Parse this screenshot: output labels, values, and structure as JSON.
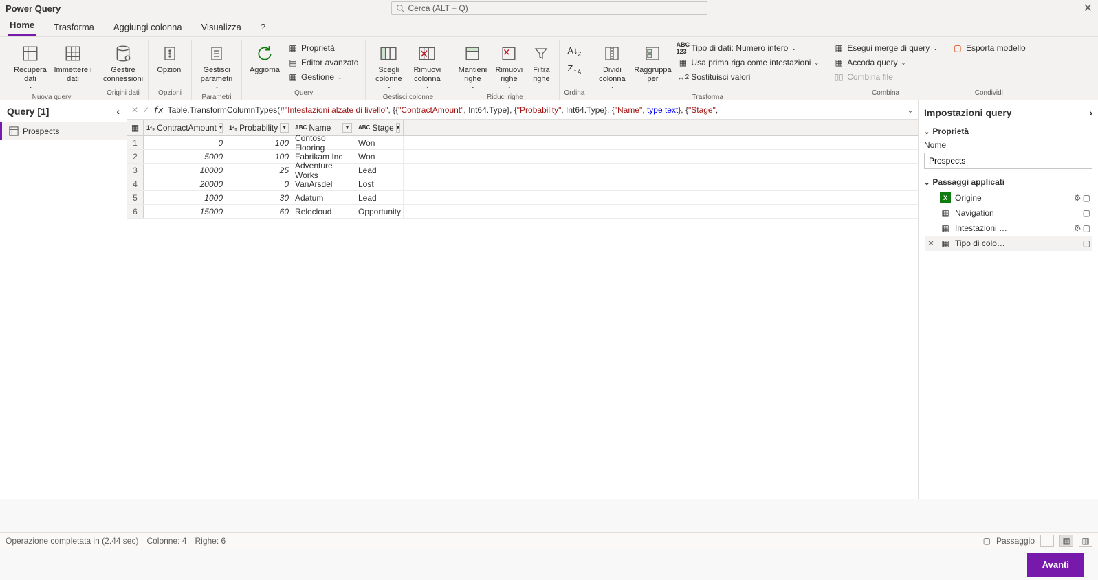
{
  "app_title": "Power Query",
  "search_placeholder": "Cerca (ALT + Q)",
  "tabs": [
    "Home",
    "Trasforma",
    "Aggiungi colonna",
    "Visualizza",
    "?"
  ],
  "active_tab": 0,
  "ribbon": {
    "groups": {
      "nuova_query": {
        "label": "Nuova query",
        "recupera": "Recupera dati",
        "immettere": "Immettere i dati"
      },
      "origini_dati": {
        "label": "Origini dati",
        "gestire": "Gestire connessioni"
      },
      "opzioni": {
        "label": "Opzioni",
        "opzioni": "Opzioni"
      },
      "parametri": {
        "label": "Parametri",
        "gestisci": "Gestisci parametri"
      },
      "query": {
        "label": "Query",
        "aggiorna": "Aggiorna",
        "proprieta": "Proprietà",
        "editor": "Editor avanzato",
        "gestione": "Gestione"
      },
      "gestisci_colonne": {
        "label": "Gestisci colonne",
        "scegli": "Scegli colonne",
        "rimuovi": "Rimuovi colonna"
      },
      "riduci_righe": {
        "label": "Riduci righe",
        "mantieni": "Mantieni righe",
        "rimuovi": "Rimuovi righe",
        "filtra": "Filtra righe"
      },
      "ordina": {
        "label": "Ordina"
      },
      "trasforma": {
        "label": "Trasforma",
        "dividi": "Dividi colonna",
        "raggruppa": "Raggruppa per",
        "tipo": "Tipo di dati: Numero intero",
        "prima_riga": "Usa prima riga come intestazioni",
        "sostituisci": "Sostituisci valori"
      },
      "combina": {
        "label": "Combina",
        "merge": "Esegui merge di query",
        "accoda": "Accoda query",
        "combina_file": "Combina file"
      },
      "condividi": {
        "label": "Condividi",
        "esporta": "Esporta modello"
      }
    }
  },
  "query_panel": {
    "title": "Query [1]",
    "items": [
      "Prospects"
    ]
  },
  "formula_prefix": "Table.TransformColumnTypes(#",
  "formula_parts": {
    "p0": "\"Intestazioni alzate di livello\"",
    "p1": ", {{",
    "p2": "\"ContractAmount\"",
    "p3": ", Int64.Type}, {",
    "p4": "\"Probability\"",
    "p5": ", Int64.Type}, {",
    "p6": "\"Name\"",
    "p7": ", ",
    "p8": "type text",
    "p9": "}, {",
    "p10": "\"Stage\"",
    "p11": ","
  },
  "columns": [
    {
      "name": "ContractAmount",
      "type": "1²₃"
    },
    {
      "name": "Probability",
      "type": "1²₃"
    },
    {
      "name": "Name",
      "type": "ABC"
    },
    {
      "name": "Stage",
      "type": "ABC"
    }
  ],
  "rows": [
    {
      "n": "1",
      "c0": "0",
      "c1": "100",
      "c2": "Contoso Flooring",
      "c3": "Won"
    },
    {
      "n": "2",
      "c0": "5000",
      "c1": "100",
      "c2": "Fabrikam Inc",
      "c3": "Won"
    },
    {
      "n": "3",
      "c0": "10000",
      "c1": "25",
      "c2": "Adventure Works",
      "c3": "Lead"
    },
    {
      "n": "4",
      "c0": "20000",
      "c1": "0",
      "c2": "VanArsdel",
      "c3": "Lost"
    },
    {
      "n": "5",
      "c0": "1000",
      "c1": "30",
      "c2": "Adatum",
      "c3": "Lead"
    },
    {
      "n": "6",
      "c0": "15000",
      "c1": "60",
      "c2": "Relecloud",
      "c3": "Opportunity"
    }
  ],
  "settings": {
    "title": "Impostazioni query",
    "proprieta": "Proprietà",
    "nome_label": "Nome",
    "nome_value": "Prospects",
    "passaggi": "Passaggi applicati",
    "steps": [
      {
        "label": "Origine",
        "gear": true,
        "excel": true
      },
      {
        "label": "Navigation",
        "gear": false
      },
      {
        "label": "Intestazioni …",
        "gear": true
      },
      {
        "label": "Tipo di colo…",
        "gear": false,
        "active": true,
        "del": true
      }
    ]
  },
  "status": {
    "op": "Operazione completata in (2.44 sec)",
    "cols": "Colonne: 4",
    "rows": "Righe: 6",
    "passaggio": "Passaggio"
  },
  "footer_btn": "Avanti"
}
